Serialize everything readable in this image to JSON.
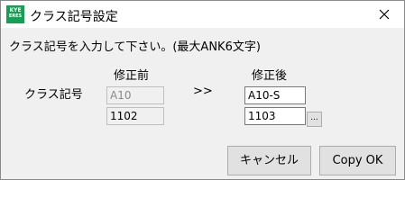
{
  "window": {
    "title": "クラス記号設定",
    "app_icon": {
      "line1": "KYE",
      "line2": "ERES",
      "name": "app-logo-icon",
      "color": "#14a052"
    },
    "close_icon": "close-icon"
  },
  "dialog": {
    "instruction": "クラス記号を入力して下さい。(最大ANK6文字)",
    "header_before": "修正前",
    "header_after": "修正後",
    "class_label": "クラス記号",
    "arrow": ">>",
    "before": {
      "code": "A10",
      "number": "1102"
    },
    "after": {
      "code": "A10-S",
      "number": "1103"
    },
    "browse_label": "..."
  },
  "buttons": {
    "cancel": "キャンセル",
    "ok": "Copy OK"
  }
}
